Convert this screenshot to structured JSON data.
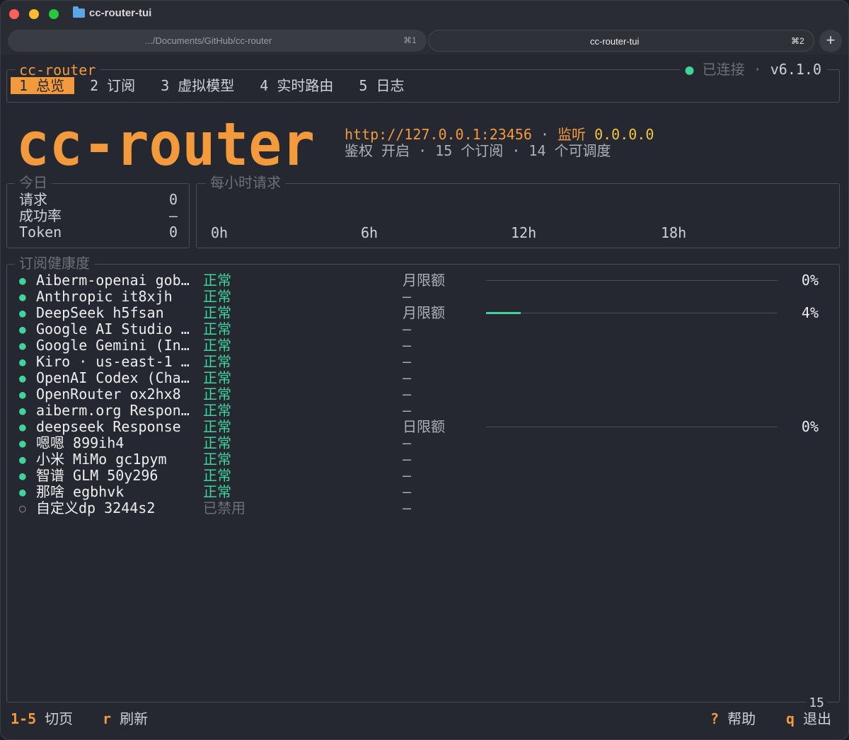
{
  "window": {
    "title": "cc-router-tui"
  },
  "tabs": [
    {
      "label": ".../Documents/GitHub/cc-router",
      "shortcut": "⌘1"
    },
    {
      "label": "cc-router-tui",
      "shortcut": "⌘2"
    }
  ],
  "new_tab_label": "+",
  "app": {
    "name": "cc-router",
    "nav": [
      {
        "label": "1 总览"
      },
      {
        "label": "2 订阅"
      },
      {
        "label": "3 虚拟模型"
      },
      {
        "label": "4 实时路由"
      },
      {
        "label": "5 日志"
      }
    ],
    "status": {
      "dot": "●",
      "text": "已连接",
      "sep": "·",
      "version": "v6.1.0"
    },
    "logo_text": "cc-router",
    "server": {
      "url": "http://127.0.0.1:23456",
      "sep": "·",
      "listen_label": "监听",
      "listen_addr": "0.0.0.0",
      "line2": "鉴权 开启 · 15 个订阅 · 14 个可调度"
    }
  },
  "today": {
    "title": "今日",
    "rows": [
      {
        "label": "请求",
        "value": "0"
      },
      {
        "label": "成功率",
        "value": "—"
      },
      {
        "label": "Token",
        "value": "0"
      }
    ]
  },
  "hourly": {
    "title": "每小时请求",
    "ticks": [
      "0h",
      "6h",
      "12h",
      "18h"
    ]
  },
  "health": {
    "title": "订阅健康度",
    "rows": [
      {
        "name": "Aiberm-openai gob…",
        "status": "正常",
        "limit": "月限额",
        "usage": 0,
        "pct": "0%",
        "enabled": true
      },
      {
        "name": "Anthropic it8xjh",
        "status": "正常",
        "limit": "—",
        "enabled": true
      },
      {
        "name": "DeepSeek h5fsan",
        "status": "正常",
        "limit": "月限额",
        "usage": 0.04,
        "pct": "4%",
        "enabled": true
      },
      {
        "name": "Google AI Studio …",
        "status": "正常",
        "limit": "—",
        "enabled": true
      },
      {
        "name": "Google Gemini (In…",
        "status": "正常",
        "limit": "—",
        "enabled": true
      },
      {
        "name": "Kiro · us-east-1 …",
        "status": "正常",
        "limit": "—",
        "enabled": true
      },
      {
        "name": "OpenAI Codex (Cha…",
        "status": "正常",
        "limit": "—",
        "enabled": true
      },
      {
        "name": "OpenRouter ox2hx8",
        "status": "正常",
        "limit": "—",
        "enabled": true
      },
      {
        "name": "aiberm.org Respon…",
        "status": "正常",
        "limit": "—",
        "enabled": true
      },
      {
        "name": "deepseek Response",
        "status": "正常",
        "limit": "日限额",
        "usage": 0,
        "pct": "0%",
        "enabled": true
      },
      {
        "name": "嗯嗯 899ih4",
        "status": "正常",
        "limit": "—",
        "enabled": true
      },
      {
        "name": "小米 MiMo gc1pym",
        "status": "正常",
        "limit": "—",
        "enabled": true
      },
      {
        "name": "智谱 GLM 50y296",
        "status": "正常",
        "limit": "—",
        "enabled": true
      },
      {
        "name": "那啥 egbhvk",
        "status": "正常",
        "limit": "—",
        "enabled": true
      },
      {
        "name": "自定义dp 3244s2",
        "status": "已禁用",
        "limit": "—",
        "enabled": false
      }
    ]
  },
  "page_count": "15",
  "footer": {
    "left": [
      {
        "key": "1-5",
        "label": "切页"
      },
      {
        "key": "r",
        "label": "刷新"
      }
    ],
    "right": [
      {
        "key": "?",
        "label": "帮助"
      },
      {
        "key": "q",
        "label": "退出"
      }
    ]
  },
  "colors": {
    "accent": "#f39a3c",
    "ok": "#3fd49b",
    "highlight": "#f4c542"
  }
}
